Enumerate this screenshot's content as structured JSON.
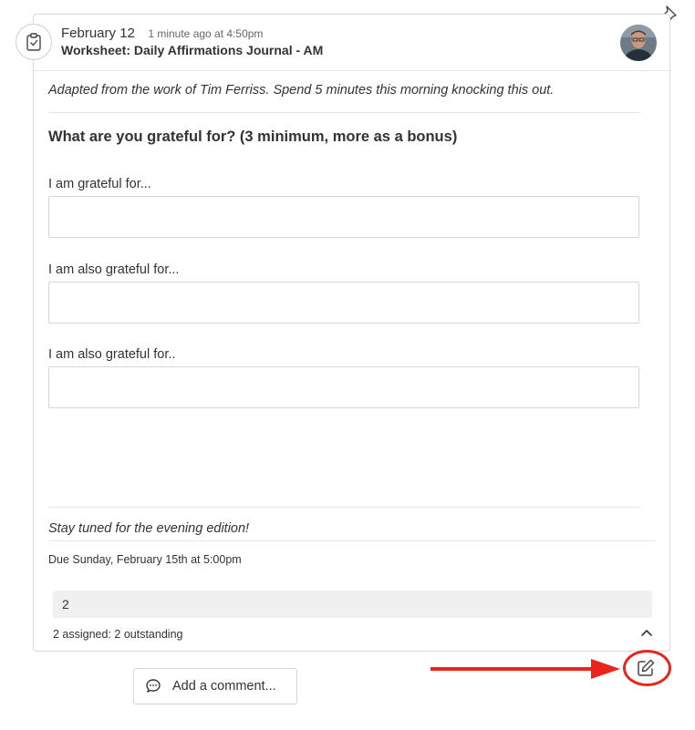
{
  "post": {
    "date": "February 12",
    "timestamp": "1 minute ago at 4:50pm",
    "title": "Worksheet: Daily Affirmations Journal - AM",
    "type_icon": "clipboard-check-icon",
    "avatar": "author-avatar"
  },
  "worksheet": {
    "intro": "Adapted from the work of Tim Ferriss. Spend 5 minutes this morning knocking this out.",
    "question": "What are you grateful for? (3 minimum, more as a bonus)",
    "fields": [
      {
        "label": "I am grateful for...",
        "value": ""
      },
      {
        "label": "I am also grateful for...",
        "value": ""
      },
      {
        "label": "I am also grateful for..",
        "value": ""
      }
    ],
    "outro": "Stay tuned for the evening edition!",
    "due": "Due Sunday, February 15th at 5:00pm"
  },
  "assignment": {
    "count": "2",
    "summary": "2 assigned: 2 outstanding"
  },
  "comment": {
    "label": "Add a comment..."
  },
  "icons": {
    "pin": "pin-icon",
    "edit": "edit-icon",
    "collapse": "chevron-up-icon",
    "comment": "speech-bubble-icon"
  },
  "colors": {
    "annotation_red": "#e8241c",
    "panel_gray": "#f0f0f0",
    "border": "#d9d9d9"
  }
}
